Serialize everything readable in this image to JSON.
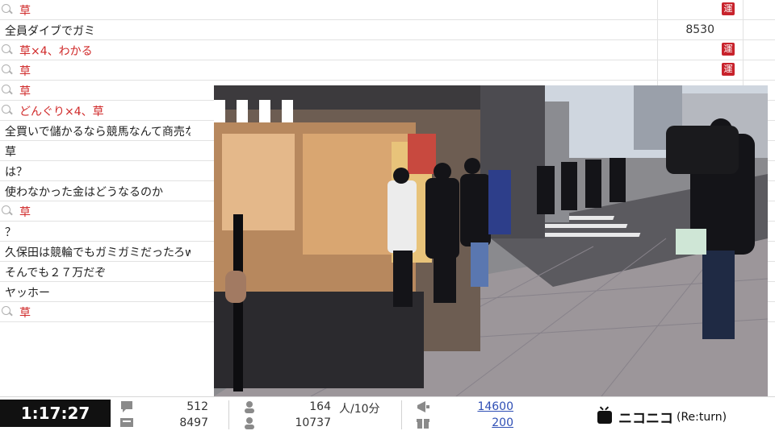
{
  "comments": [
    {
      "text": "草",
      "highlight": true,
      "number": "",
      "badge": "運"
    },
    {
      "text": "全員ダイブでガミ",
      "highlight": false,
      "number": "8530",
      "badge": ""
    },
    {
      "text": "草×4、わかる",
      "highlight": true,
      "number": "",
      "badge": "運"
    },
    {
      "text": "草",
      "highlight": true,
      "number": "",
      "badge": "運"
    },
    {
      "text": "草",
      "highlight": true,
      "number": "",
      "badge": ""
    },
    {
      "text": "どんぐり×4、草",
      "highlight": true,
      "number": "",
      "badge": ""
    },
    {
      "text": "全買いで儲かるなら競馬なんて商売なり",
      "highlight": false,
      "number": "",
      "badge": ""
    },
    {
      "text": "草",
      "highlight": false,
      "number": "",
      "badge": ""
    },
    {
      "text": "は？",
      "highlight": false,
      "number": "",
      "badge": ""
    },
    {
      "text": "使わなかった金はどうなるのか",
      "highlight": false,
      "number": "",
      "badge": ""
    },
    {
      "text": "草",
      "highlight": true,
      "number": "",
      "badge": ""
    },
    {
      "text": "？",
      "highlight": false,
      "number": "",
      "badge": ""
    },
    {
      "text": "久保田は競輪でもガミガミだったろw",
      "highlight": false,
      "number": "",
      "badge": ""
    },
    {
      "text": "そんでも２７万だぞ",
      "highlight": false,
      "number": "",
      "badge": ""
    },
    {
      "text": "ヤッホー",
      "highlight": false,
      "number": "",
      "badge": ""
    },
    {
      "text": "草",
      "highlight": true,
      "number": "",
      "badge": ""
    }
  ],
  "status": {
    "elapsed_time": "1:17:27",
    "comments_count": "512",
    "comments_total": "8497",
    "viewers_recent": "164",
    "viewers_unit": "人/10分",
    "viewers_total": "10737",
    "ad_points": "14600",
    "gift_points": "200"
  },
  "logo": {
    "name": "ニコニコ",
    "suffix": "(Re:turn)"
  }
}
